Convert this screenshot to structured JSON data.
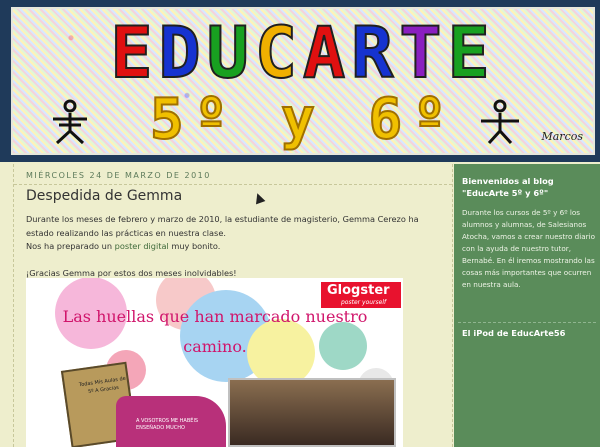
{
  "header": {
    "title_letters": [
      "E",
      "D",
      "U",
      "C",
      "A",
      "R",
      "T",
      "E"
    ],
    "subtitle": "5º y 6º",
    "signature": "Marcos"
  },
  "post": {
    "date": "miércoles 24 de marzo de 2010",
    "title": "Despedida de Gemma",
    "paragraph1": "Durante los meses de febrero y marzo de 2010, la estudiante de magisterio, Gemma Cerezo ha estado realizando las prácticas en nuestra clase.",
    "paragraph2_pre": "Nos ha preparado un ",
    "paragraph2_link": "poster digital",
    "paragraph2_post": " muy bonito.",
    "paragraph3": "¡Gracias Gemma por estos dos meses inolvidables!"
  },
  "poster": {
    "brand": "Glogster",
    "brand_tagline": "poster yourself",
    "headline": "Las huellas que han marcado nuestro camino.",
    "tag_text": "Todas Mis Aulas de 5º A Gracias",
    "puzzle_text": "A VOSOTROS ME HABÉIS ENSEÑADO MUCHO"
  },
  "sidebar": {
    "welcome_title": "Bienvenidos al blog \"EducArte 5º y 6º\"",
    "welcome_text": "Durante los cursos de 5º y 6º los alumnos y alumnas, de Salesianos Atocha, vamos a crear nuestro diario con la ayuda de nuestro tutor, Bernabé. En él iremos mostrando las cosas más importantes que ocurren en nuestra aula.",
    "ipod_title": "El iPod de EducArte56"
  }
}
